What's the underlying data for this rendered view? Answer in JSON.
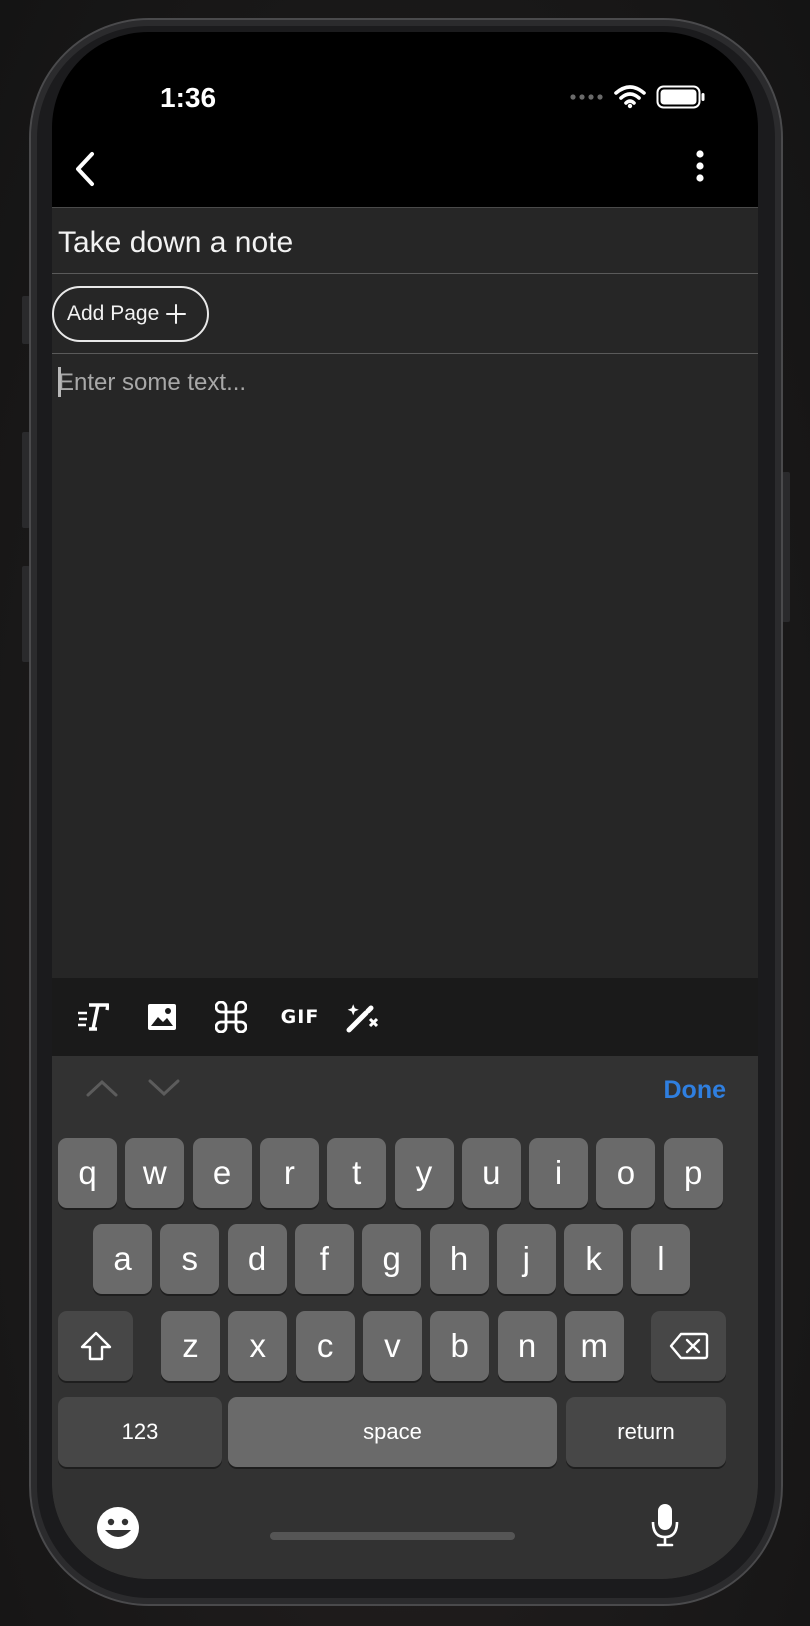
{
  "status_bar": {
    "time": "1:36"
  },
  "note": {
    "title": "Take down a note",
    "add_page_label": "Add Page",
    "editor_placeholder": "Enter some text..."
  },
  "toolbar": {
    "icons": [
      "text-style-icon",
      "image-icon",
      "command-icon",
      "gif-icon",
      "magic-wand-icon"
    ],
    "gif_label": "GIF"
  },
  "keyboard": {
    "done_label": "Done",
    "row1": [
      "q",
      "w",
      "e",
      "r",
      "t",
      "y",
      "u",
      "i",
      "o",
      "p"
    ],
    "row2": [
      "a",
      "s",
      "d",
      "f",
      "g",
      "h",
      "j",
      "k",
      "l"
    ],
    "row3": [
      "z",
      "x",
      "c",
      "v",
      "b",
      "n",
      "m"
    ],
    "numbers_label": "123",
    "space_label": "space",
    "return_label": "return"
  },
  "colors": {
    "accent": "#2f7fe0",
    "background": "#262626",
    "keyboard": "#323232"
  }
}
